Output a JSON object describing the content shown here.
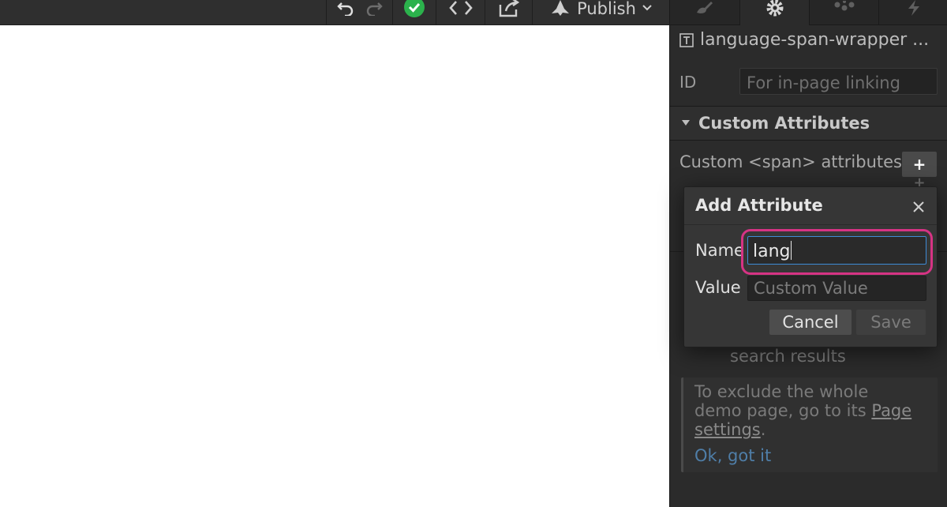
{
  "toolbar": {
    "publish_label": "Publish",
    "icons": [
      "undo-icon",
      "redo-icon",
      "check-circle-icon",
      "code-icon",
      "export-icon",
      "publish-icon",
      "chevron-down-icon"
    ],
    "colors": {
      "check": "#2bb24c"
    }
  },
  "panel": {
    "tabs": [
      "style-brush-icon",
      "settings-gear-icon",
      "interactions-icon",
      "lightning-icon"
    ],
    "element_name": "language-span-wrapper ...",
    "id_label": "ID",
    "id_placeholder": "For in-page linking",
    "section_title": "Custom Attributes",
    "custom_attributes_label": "Custom <span> attributes",
    "add_button_label": "+",
    "search_results_text": "search results",
    "info": {
      "line1": "To exclude the whole",
      "line2_prefix": "demo page, go to its",
      "line2_link": "Page",
      "line3_link": "settings",
      "line3_suffix": ".",
      "ok_label": "Ok, got it"
    }
  },
  "modal": {
    "title": "Add Attribute",
    "name_label": "Name",
    "name_value": "lang",
    "value_label": "Value",
    "value_placeholder": "Custom Value",
    "cancel_label": "Cancel",
    "save_label": "Save",
    "highlight_color": "#d63384"
  }
}
